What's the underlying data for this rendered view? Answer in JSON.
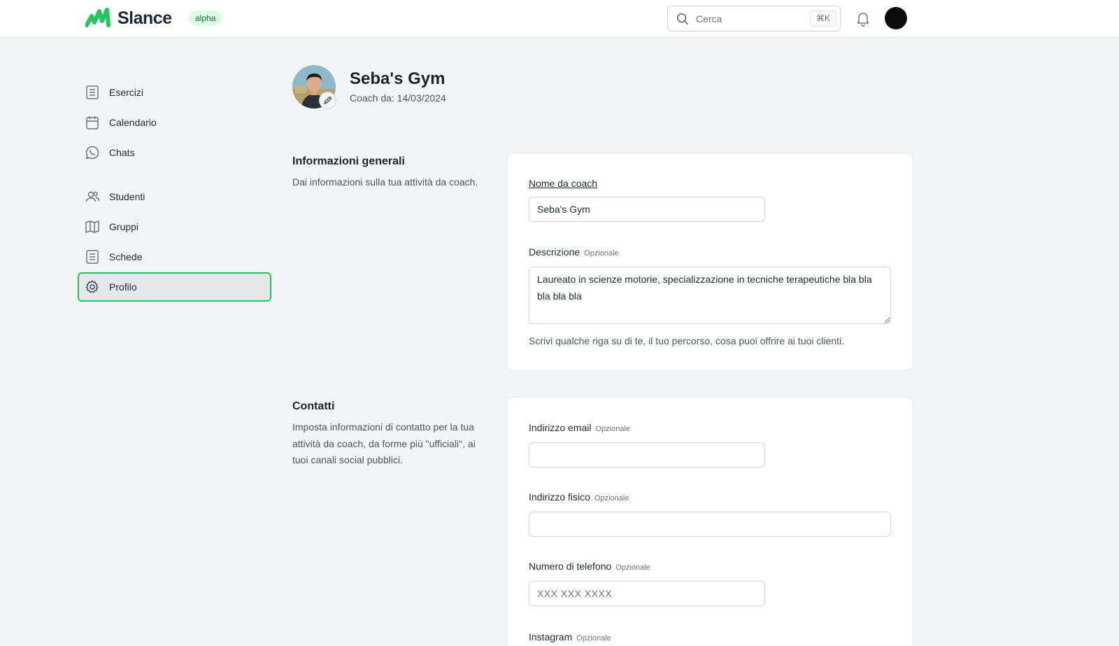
{
  "app": {
    "name": "Slance",
    "badge": "alpha",
    "brand_color": "#22c55e"
  },
  "header": {
    "search_placeholder": "Cerca",
    "search_shortcut": "⌘K",
    "icons": [
      "search-icon",
      "bell-icon",
      "user-avatar"
    ]
  },
  "sidebar": {
    "items": [
      {
        "label": "Esercizi",
        "icon": "document-list-icon"
      },
      {
        "label": "Calendario",
        "icon": "calendar-icon"
      },
      {
        "label": "Chats",
        "icon": "chat-icon"
      },
      {
        "label": "Studenti",
        "icon": "users-icon"
      },
      {
        "label": "Gruppi",
        "icon": "map-icon"
      },
      {
        "label": "Schede",
        "icon": "document-list-icon"
      },
      {
        "label": "Profilo",
        "icon": "gear-icon",
        "active": true
      }
    ]
  },
  "profile": {
    "name": "Seba's Gym",
    "coach_since": "Coach da: 14/03/2024"
  },
  "general": {
    "title": "Informazioni generali",
    "description": "Dai informazioni sulla tua attività da coach.",
    "coach_name_label": "Nome da coach",
    "coach_name_value": "Seba's Gym",
    "description_label": "Descrizione",
    "optional": "Opzionale",
    "description_value": "Laureato in scienze motorie, specializzazione in tecniche terapeutiche bla bla bla bla bla",
    "description_hint": "Scrivi qualche riga su di te, il tuo percorso, cosa puoi offrire ai tuoi clienti."
  },
  "contacts": {
    "title": "Contatti",
    "description": "Imposta informazioni di contatto per la tua attività da coach, da forme più \"ufficiali\", ai tuoi canali social pubblici.",
    "email_label": "Indirizzo email",
    "address_label": "Indirizzo fisico",
    "phone_label": "Numero di telefono",
    "phone_placeholder": "XXX XXX XXXX",
    "instagram_label": "Instagram",
    "optional": "Opzionale"
  }
}
